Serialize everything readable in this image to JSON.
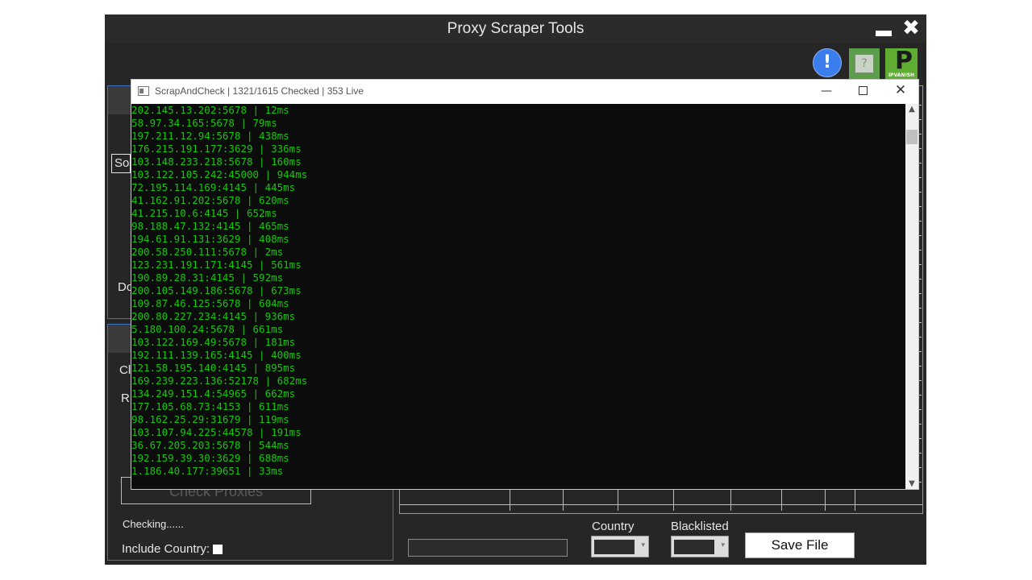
{
  "app": {
    "title": "Proxy Scraper Tools",
    "minimize_icon": "minimize-icon",
    "close_icon": "close-icon",
    "close_glyph": "✖",
    "toolbar_icons": [
      "info-icon",
      "chip-icon",
      "ipvanish-icon"
    ],
    "info_glyph": "!",
    "ipvanish_letter": "P",
    "ipvanish_text": "IPVANISH"
  },
  "left_panel": {
    "so_text": "So",
    "do_text": "Do",
    "c_text": "Cl",
    "r_text": "R",
    "check_button": "Check Proxies",
    "status": "Checking......",
    "include_country_label": "Include Country:"
  },
  "bottom": {
    "country_label": "Country",
    "blacklisted_label": "Blacklisted",
    "save_button": "Save File"
  },
  "console": {
    "title": "ScrapAndCheck | 1321/1615 Checked | 353 Live",
    "lines": [
      "202.145.13.202:5678 | 12ms",
      "58.97.34.165:5678 | 79ms",
      "197.211.12.94:5678 | 438ms",
      "176.215.191.177:3629 | 336ms",
      "103.148.233.218:5678 | 160ms",
      "103.122.105.242:45000 | 944ms",
      "72.195.114.169:4145 | 445ms",
      "41.162.91.202:5678 | 620ms",
      "41.215.10.6:4145 | 652ms",
      "98.188.47.132:4145 | 465ms",
      "194.61.91.131:3629 | 408ms",
      "200.58.250.111:5678 | 2ms",
      "123.231.191.171:4145 | 561ms",
      "190.89.28.31:4145 | 592ms",
      "200.105.149.186:5678 | 673ms",
      "109.87.46.125:5678 | 604ms",
      "200.80.227.234:4145 | 936ms",
      "5.180.100.24:5678 | 661ms",
      "103.122.169.49:5678 | 181ms",
      "192.111.139.165:4145 | 400ms",
      "121.58.195.140:4145 | 895ms",
      "169.239.223.136:52178 | 682ms",
      "134.249.151.4:54965 | 662ms",
      "177.105.68.73:4153 | 611ms",
      "98.162.25.29:31679 | 119ms",
      "103.107.94.225:44578 | 191ms",
      "36.67.205.203:5678 | 544ms",
      "192.159.39.30:3629 | 688ms",
      "1.186.40.177:39651 | 33ms"
    ]
  },
  "colors": {
    "console_text": "#16c60c",
    "accent_border": "#3d73c0",
    "app_bg": "#252525"
  }
}
